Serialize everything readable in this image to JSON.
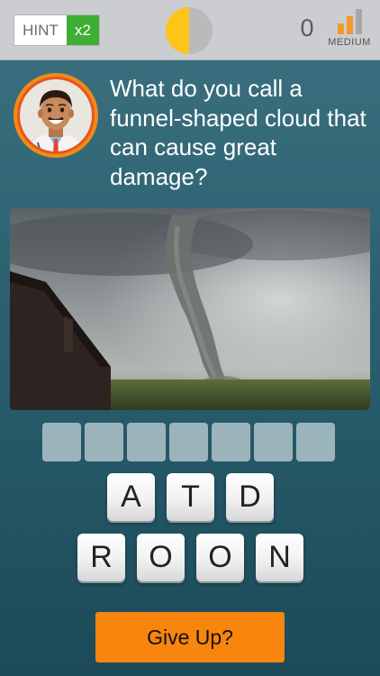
{
  "topbar": {
    "hint_label": "HINT",
    "hint_count": "x2",
    "timer_progress": 0.5,
    "score": "0",
    "difficulty_label": "MEDIUM",
    "difficulty_level": 2,
    "difficulty_max": 3
  },
  "question": {
    "avatar": "doctor-avatar",
    "text": "What do you call a funnel-shaped cloud that can cause great damage?"
  },
  "image": {
    "subject": "tornado-photo"
  },
  "answer": {
    "slot_count": 7
  },
  "letters": {
    "row1": [
      "A",
      "T",
      "D"
    ],
    "row2": [
      "R",
      "O",
      "O",
      "N"
    ]
  },
  "actions": {
    "give_up_label": "Give Up?"
  },
  "colors": {
    "hint_green": "#3fae34",
    "timer_yellow": "#fdc51a",
    "timer_gray": "#b9babc",
    "difficulty_orange": "#f39a2a",
    "difficulty_gray": "#a7a7a7",
    "slot_blue": "#9bb4bc",
    "button_orange": "#f7850e"
  }
}
